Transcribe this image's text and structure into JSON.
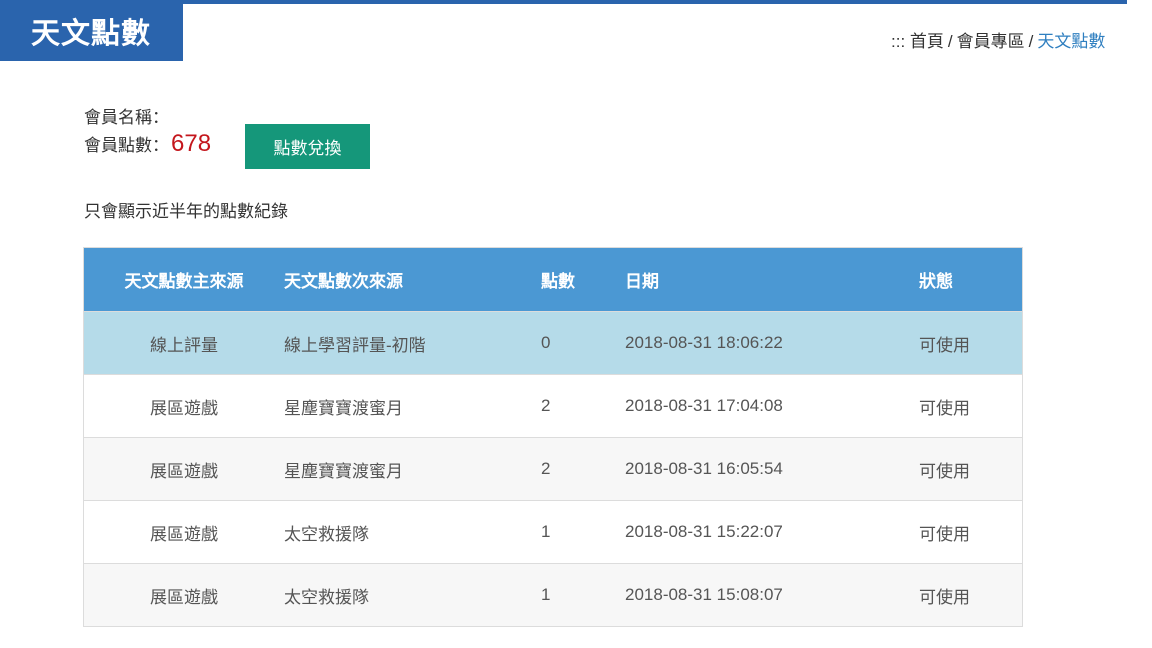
{
  "header": {
    "title": "天文點數",
    "breadcrumb": {
      "prefix": ":::",
      "home": "首頁",
      "section": "會員專區",
      "current": "天文點數",
      "separator": "/"
    }
  },
  "member": {
    "name_label": "會員名稱：",
    "name_value": "",
    "points_label": "會員點數：",
    "points_value": "678",
    "redeem_button": "點數兌換"
  },
  "notice": "只會顯示近半年的點數紀錄",
  "table": {
    "headers": [
      "天文點數主來源",
      "天文點數次來源",
      "點數",
      "日期",
      "狀態"
    ],
    "rows": [
      [
        "線上評量",
        "線上學習評量-初階",
        "0",
        "2018-08-31 18:06:22",
        "可使用"
      ],
      [
        "展區遊戲",
        "星塵寶寶渡蜜月",
        "2",
        "2018-08-31 17:04:08",
        "可使用"
      ],
      [
        "展區遊戲",
        "星塵寶寶渡蜜月",
        "2",
        "2018-08-31 16:05:54",
        "可使用"
      ],
      [
        "展區遊戲",
        "太空救援隊",
        "1",
        "2018-08-31 15:22:07",
        "可使用"
      ],
      [
        "展區遊戲",
        "太空救援隊",
        "1",
        "2018-08-31 15:08:07",
        "可使用"
      ]
    ]
  },
  "colors": {
    "brand_blue": "#2a64ad",
    "table_header": "#4b98d3",
    "highlight_row": "#b5dbe9",
    "redeem_button": "#15977a",
    "points_red": "#c4161c"
  }
}
